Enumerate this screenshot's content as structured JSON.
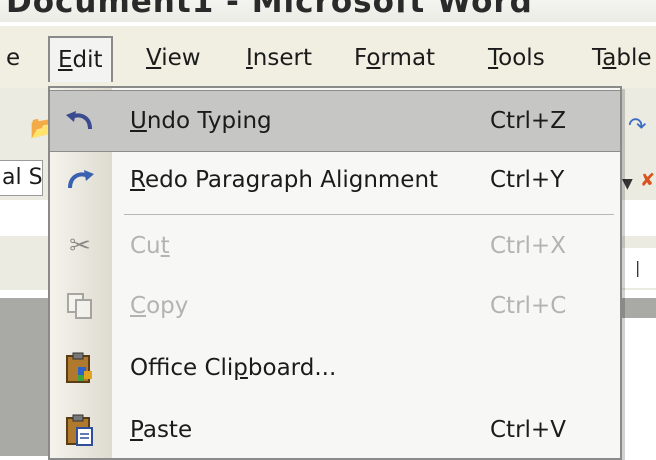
{
  "window": {
    "title": "Document1 - Microsoft Word"
  },
  "menubar": {
    "items": [
      {
        "label": "e",
        "underline_index": -1
      },
      {
        "label": "Edit",
        "underline_index": 0
      },
      {
        "label": "View",
        "underline_index": 0
      },
      {
        "label": "Insert",
        "underline_index": 0
      },
      {
        "label": "Format",
        "underline_index": 1
      },
      {
        "label": "Tools",
        "underline_index": 0
      },
      {
        "label": "Table",
        "underline_index": 1
      }
    ]
  },
  "toolbar": {
    "font_box_text": "al S"
  },
  "edit_menu": {
    "items": [
      {
        "id": "undo",
        "label": "Undo Typing",
        "underline_index": 0,
        "shortcut": "Ctrl+Z",
        "icon": "undo-icon",
        "enabled": true,
        "highlighted": true
      },
      {
        "id": "redo",
        "label": "Redo Paragraph Alignment",
        "underline_index": 0,
        "shortcut": "Ctrl+Y",
        "icon": "redo-icon",
        "enabled": true,
        "highlighted": false
      },
      {
        "id": "cut",
        "label": "Cut",
        "underline_index": 2,
        "shortcut": "Ctrl+X",
        "icon": "scissors-icon",
        "enabled": false,
        "highlighted": false
      },
      {
        "id": "copy",
        "label": "Copy",
        "underline_index": 0,
        "shortcut": "Ctrl+C",
        "icon": "copy-icon",
        "enabled": false,
        "highlighted": false
      },
      {
        "id": "clipboard",
        "label": "Office Clipboard...",
        "underline_index": 10,
        "shortcut": "",
        "icon": "clipboard-icon",
        "enabled": true,
        "highlighted": false
      },
      {
        "id": "paste",
        "label": "Paste",
        "underline_index": 0,
        "shortcut": "Ctrl+V",
        "icon": "paste-icon",
        "enabled": true,
        "highlighted": false
      }
    ]
  },
  "colors": {
    "menu_bg": "#f7f7f5",
    "highlight": "#c6c6c4",
    "disabled_text": "#b3b3b0",
    "gutter": "#dedcd0"
  }
}
